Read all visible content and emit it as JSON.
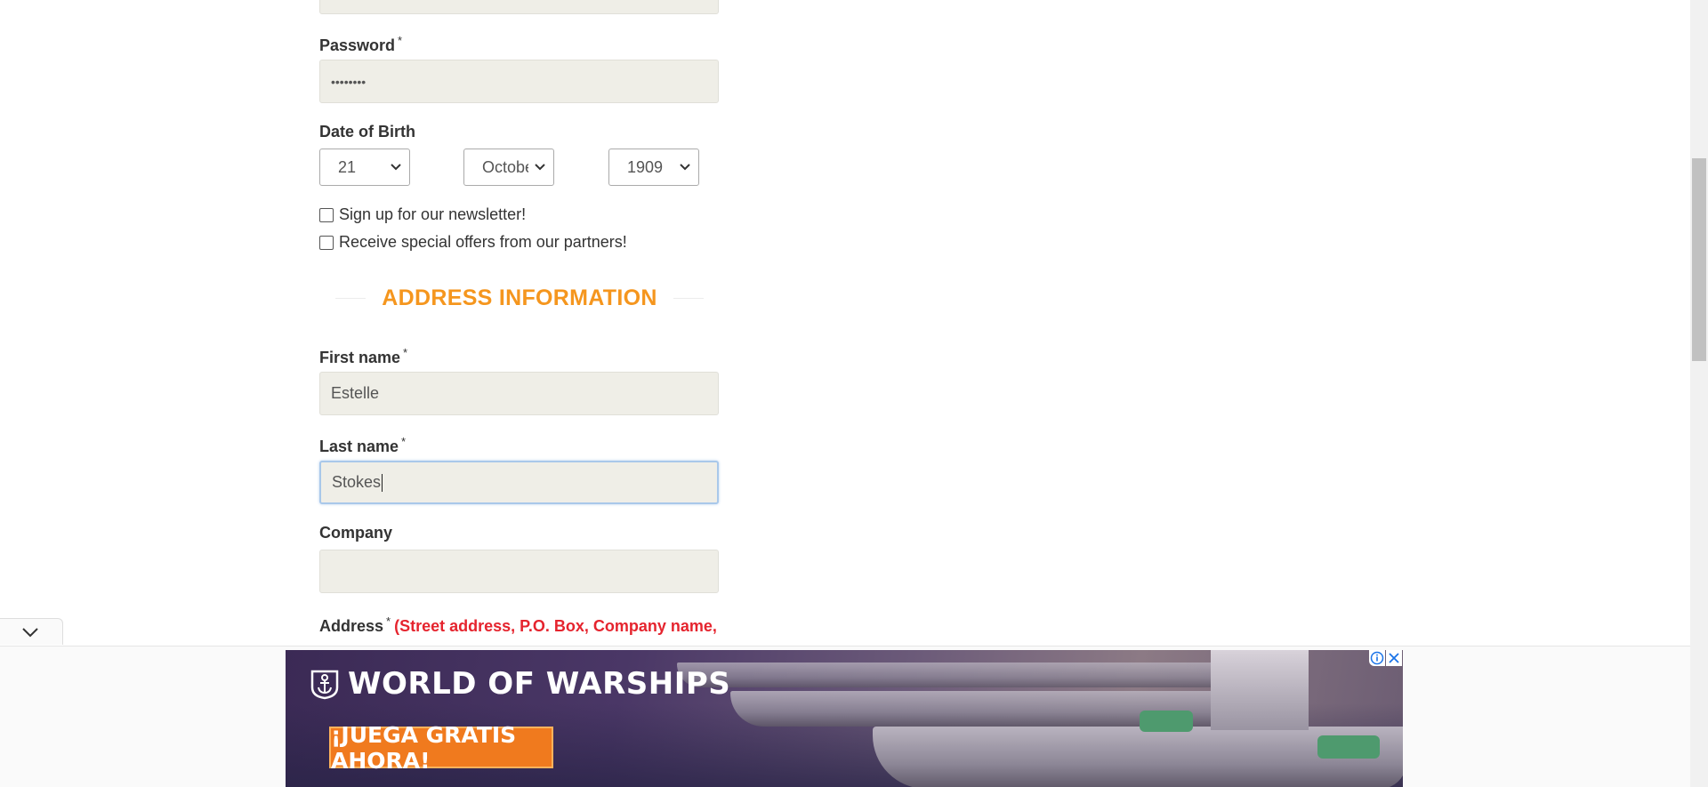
{
  "form": {
    "password_label": "Password",
    "password_value": "••••••••",
    "dob_label": "Date of Birth",
    "dob_day": "21",
    "dob_month": "October",
    "dob_year": "1909",
    "newsletter_label": "Sign up for our newsletter!",
    "offers_label": "Receive special offers from our partners!",
    "required_mark": "*"
  },
  "address_section": {
    "title": "ADDRESS INFORMATION",
    "first_name_label": "First name",
    "first_name_value": "Estelle",
    "last_name_label": "Last name",
    "last_name_value": "Stokes",
    "company_label": "Company",
    "company_value": "",
    "address_label": "Address",
    "address_hint": "(Street address, P.O. Box, Company name,"
  },
  "ad": {
    "brand": "WORLD OF WARSHIPS",
    "cta": "¡JUEGA GRATIS AHORA!",
    "info_icon": "info-icon",
    "close_icon": "close-icon"
  },
  "colors": {
    "section_title": "#f5961e",
    "hint_red": "#e5242e",
    "input_bg": "#efeee7",
    "cta_orange": "#f07a1e"
  }
}
